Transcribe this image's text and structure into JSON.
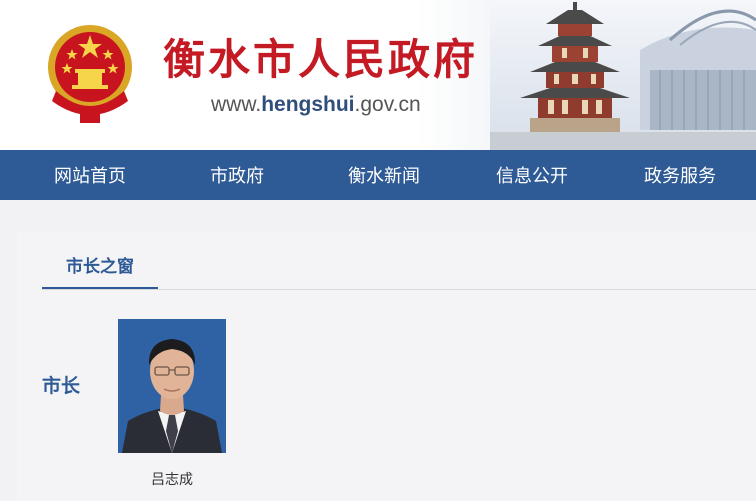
{
  "header": {
    "title": "衡水市人民政府",
    "url_prefix": "www.",
    "url_bold": "hengshui",
    "url_suffix": ".gov.cn",
    "emblem_icon": "national-emblem-icon",
    "brand_red": "#c41a24"
  },
  "nav": {
    "bg_color": "#2e5a95",
    "items": [
      {
        "label": "网站首页"
      },
      {
        "label": "市政府"
      },
      {
        "label": "衡水新闻"
      },
      {
        "label": "信息公开"
      },
      {
        "label": "政务服务"
      }
    ]
  },
  "content": {
    "tab_label": "市长之窗",
    "role_label": "市长",
    "person_name": "吕志成"
  }
}
